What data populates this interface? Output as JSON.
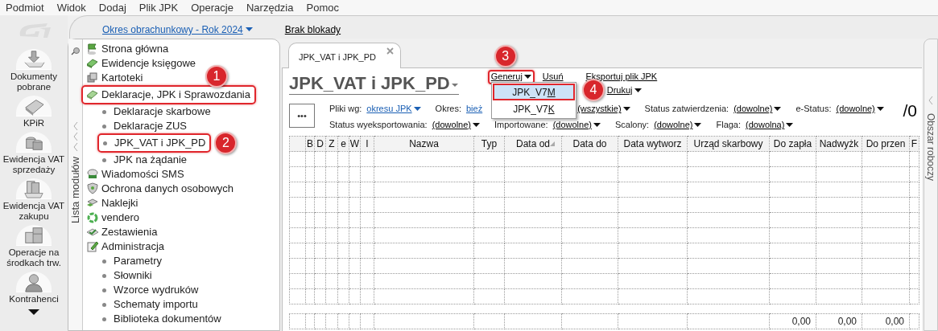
{
  "menu": [
    "Podmiot",
    "Widok",
    "Dodaj",
    "Plik JPK",
    "Operacje",
    "Narzędzia",
    "Pomoc"
  ],
  "rail": {
    "items": [
      {
        "label": "Dokumenty pobrane"
      },
      {
        "label": "KPiR"
      },
      {
        "label": "Ewidencja VAT sprzedaży"
      },
      {
        "label": "Ewidencja VAT zakupu"
      },
      {
        "label": "Operacje na środkach trw."
      },
      {
        "label": "Kontrahenci"
      }
    ]
  },
  "top_bar": {
    "period": "Okres obrachunkowy - Rok 2024",
    "lock": "Brak blokady"
  },
  "module_panel": {
    "title": "Lista modułów",
    "tree": [
      {
        "label": "Strona główna"
      },
      {
        "label": "Ewidencje księgowe"
      },
      {
        "label": "Kartoteki"
      },
      {
        "label": "Deklaracje, JPK i Sprawozdania",
        "callout": "1",
        "children": [
          {
            "label": "Deklaracje skarbowe"
          },
          {
            "label": "Deklaracje ZUS"
          },
          {
            "label": "JPK_VAT i JPK_PD",
            "callout": "2"
          },
          {
            "label": "JPK na żądanie"
          }
        ]
      },
      {
        "label": "Wiadomości SMS"
      },
      {
        "label": "Ochrona danych osobowych"
      },
      {
        "label": "Naklejki"
      },
      {
        "label": "vendero"
      },
      {
        "label": "Zestawienia"
      },
      {
        "label": "Administracja",
        "children": [
          {
            "label": "Parametry"
          },
          {
            "label": "Słowniki"
          },
          {
            "label": "Wzorce wydruków"
          },
          {
            "label": "Schematy importu"
          },
          {
            "label": "Biblioteka dokumentów"
          }
        ]
      }
    ]
  },
  "tabs": [
    {
      "label": "JPK_VAT i JPK_PD",
      "selected": true
    }
  ],
  "page": {
    "title": "JPK_VAT i JPK_PD",
    "actions": [
      {
        "label": "Generuj",
        "dropdown": true,
        "callout": "3"
      },
      {
        "label": "Usuń",
        "dropdown": false
      },
      {
        "label": "Eksportuj plik JPK",
        "dropdown": false
      },
      {
        "label": "Drukuj",
        "dropdown": true
      }
    ],
    "menu": [
      {
        "label": "JPK_V7M",
        "selected": true,
        "callout": "4"
      },
      {
        "label": "JPK_V7K",
        "selected": false
      }
    ],
    "filter_rows": [
      [
        {
          "label": "Pliki wg:",
          "value": "okresu JPK",
          "dropdown": true,
          "kind": "blue"
        },
        {
          "label": "Okres:",
          "value": "bież",
          "dropdown": false,
          "kind": "blue"
        },
        {
          "value": "(wszystkie)",
          "dropdown": true,
          "kind": "plain"
        },
        {
          "label": "Status zatwierdzenia:",
          "value": "(dowolne)",
          "dropdown": true,
          "kind": "plain"
        },
        {
          "label": "e-Status:",
          "value": "(dowolne)",
          "dropdown": true,
          "kind": "plain"
        }
      ],
      [
        {
          "label": "Status wyeksportowania:",
          "value": "(dowolne)",
          "dropdown": true,
          "kind": "plain"
        },
        {
          "label": "Importowane:",
          "value": "(dowolne)",
          "dropdown": true,
          "kind": "plain"
        },
        {
          "label": "Scalony:",
          "value": "(dowolne)",
          "dropdown": true,
          "kind": "plain"
        },
        {
          "label": "Flaga:",
          "value": "(dowolna)",
          "dropdown": true,
          "kind": "plain"
        }
      ]
    ],
    "count": "/0",
    "more_button": "•••"
  },
  "table": {
    "columns": [
      {
        "label": "B"
      },
      {
        "label": "D"
      },
      {
        "label": "Z"
      },
      {
        "label": "e"
      },
      {
        "label": "W"
      },
      {
        "label": "I"
      },
      {
        "label": "Nazwa"
      },
      {
        "label": "Typ"
      },
      {
        "label": "Data od",
        "sorted": true
      },
      {
        "label": "Data do"
      },
      {
        "label": "Data wytworz"
      },
      {
        "label": "Urząd skarbowy"
      },
      {
        "label": "Do zapła",
        "total": "0,00"
      },
      {
        "label": "Nadwyżk",
        "total": "0,00"
      },
      {
        "label": "Do przen",
        "total": "0,00"
      },
      {
        "label": "F"
      }
    ]
  },
  "right_panel": {
    "title": "Obszar roboczy"
  }
}
